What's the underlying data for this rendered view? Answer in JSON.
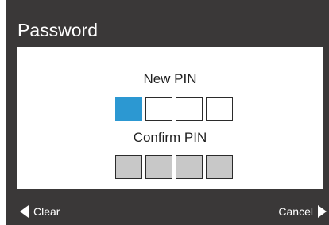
{
  "window": {
    "title": "Password"
  },
  "new_pin": {
    "label": "New PIN",
    "digits_total": 4,
    "active_index": 0
  },
  "confirm_pin": {
    "label": "Confirm PIN",
    "digits_total": 4
  },
  "softkeys": {
    "left_label": "Clear",
    "right_label": "Cancel"
  },
  "colors": {
    "bar": "#3a3838",
    "active_box": "#2c98d2",
    "inactive_box": "#c8c8c8"
  },
  "icons": {
    "left": "triangle-left-icon",
    "right": "triangle-right-icon"
  }
}
